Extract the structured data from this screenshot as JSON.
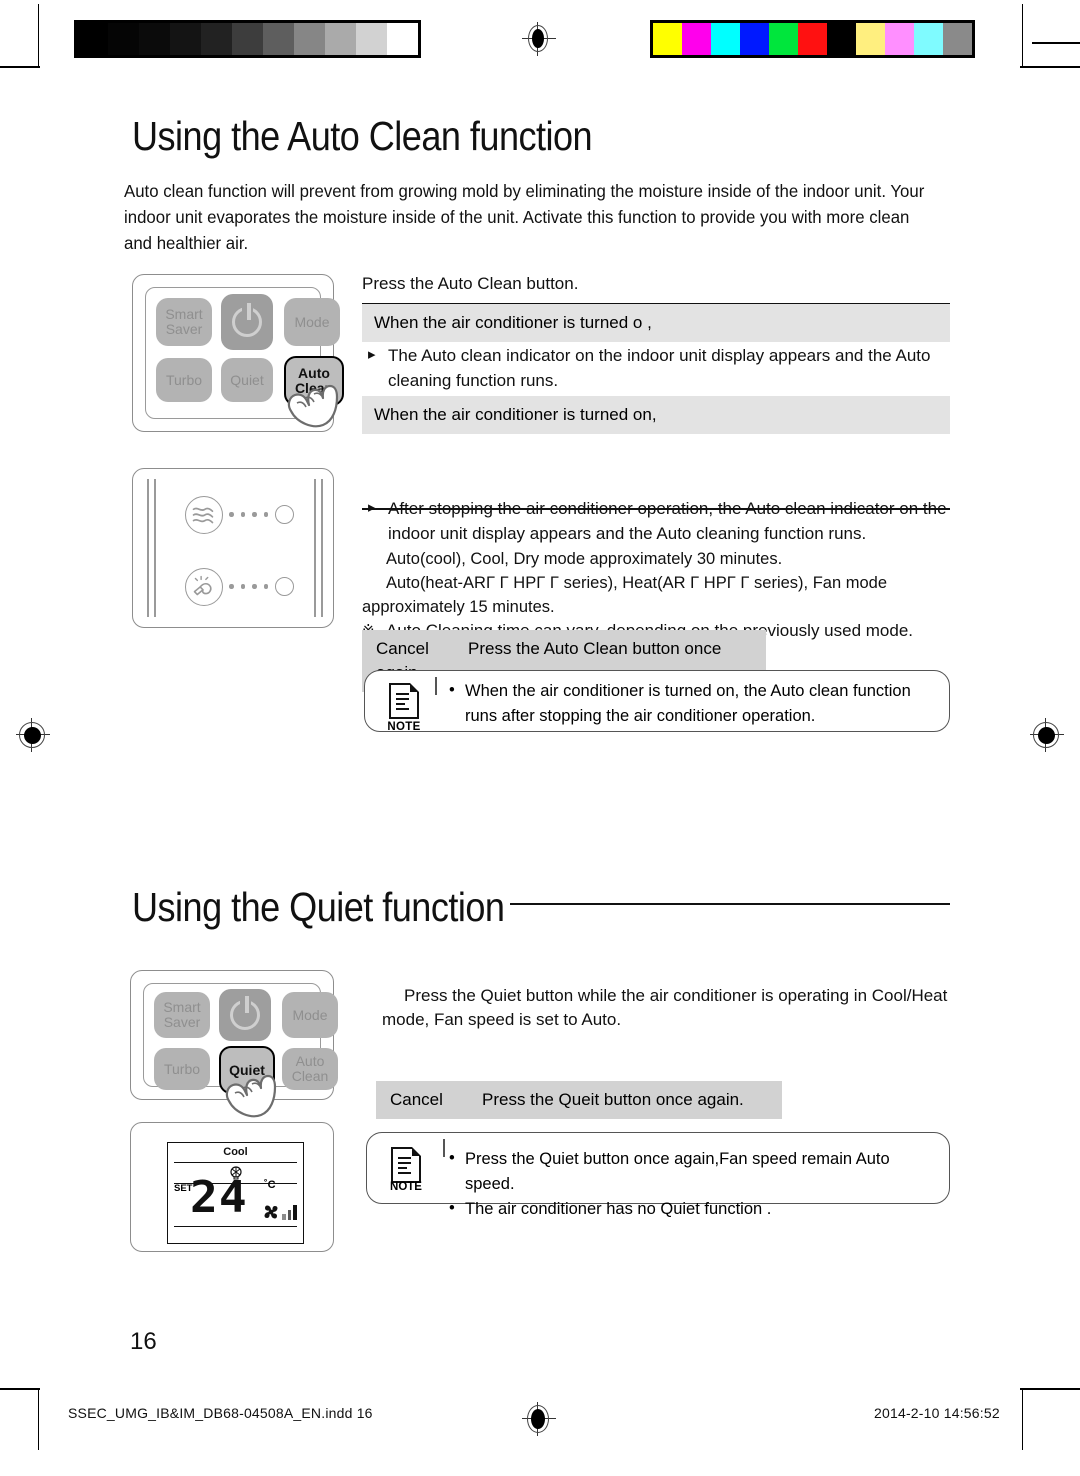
{
  "calibration": {
    "gray_steps": [
      "#000000",
      "#050505",
      "#0b0b0b",
      "#141414",
      "#222222",
      "#3d3d3d",
      "#5e5e5e",
      "#868686",
      "#aaaaaa",
      "#d2d2d2",
      "#ffffff"
    ],
    "color_swatches": [
      "#ffff00",
      "#ff00ec",
      "#00ffff",
      "#0019ff",
      "#00e63c",
      "#ff1111",
      "#000000",
      "#ffef7f",
      "#ff8fff",
      "#7ffbff",
      "#8a8a8a"
    ],
    "reg_mark": "registration-target"
  },
  "autoclean": {
    "title": "Using the Auto Clean function",
    "intro": "Auto clean function will prevent from growing mold by eliminating the moisture inside of the indoor unit. Your indoor unit evaporates the moisture inside of the unit. Activate this function to provide you with more clean and healthier air.",
    "remote": {
      "keys": [
        {
          "label_line1": "Smart",
          "label_line2": "Saver",
          "state": "normal"
        },
        {
          "label_line1": "",
          "label_line2": "",
          "state": "power"
        },
        {
          "label_line1": "Mode",
          "label_line2": "",
          "state": "normal"
        },
        {
          "label_line1": "Turbo",
          "label_line2": "",
          "state": "normal"
        },
        {
          "label_line1": "Quiet",
          "label_line2": "",
          "state": "normal"
        },
        {
          "label_line1": "Auto",
          "label_line2": "Clean",
          "state": "highlighted"
        }
      ]
    },
    "indoor_display": {
      "indicator_top": "airflow-icon",
      "indicator_bottom": "auto-clean-icon"
    },
    "lead": "Press the Auto Clean button.",
    "case_off_label": "When the air conditioner is turned o ,",
    "case_off_bullet": "The Auto clean indicator on the indoor unit display appears and the Auto cleaning function runs.",
    "case_on_label": "When the air conditioner is turned on,",
    "case_on_bullet": "After stopping the air conditioner operation, the Auto clean indicator on the indoor unit display appears and the Auto cleaning function runs.",
    "note_star": "Auto Cleaning time can vary, depending on the previously used mode.",
    "note_star_line1": "Auto(cool), Cool, Dry mode approximately 30 minutes.",
    "note_star_line2": "Auto(heat-ARΓ Γ HPΓ Γ  series), Heat(AR Γ HPΓ Γ  series), Fan mode",
    "note_star_line3": "approximately 15 minutes.",
    "cancel_label": "Cancel",
    "cancel_text": "Press the Auto Clean button once again.",
    "note_label": "NOTE",
    "note_lines": [
      "When the air conditioner is turned on, the Auto clean function runs after stopping the air conditioner operation."
    ]
  },
  "quiet": {
    "title": "Using the Quiet function",
    "remote": {
      "keys": [
        {
          "label_line1": "Smart",
          "label_line2": "Saver",
          "state": "normal"
        },
        {
          "label_line1": "",
          "label_line2": "",
          "state": "power"
        },
        {
          "label_line1": "Mode",
          "label_line2": "",
          "state": "normal"
        },
        {
          "label_line1": "Turbo",
          "label_line2": "",
          "state": "normal"
        },
        {
          "label_line1": "Quiet",
          "label_line2": "",
          "state": "highlighted"
        },
        {
          "label_line1": "Auto",
          "label_line2": "Clean",
          "state": "normal"
        }
      ]
    },
    "lcd": {
      "mode": "Cool",
      "set_label": "SET",
      "temperature": "24",
      "unit": "˚C",
      "fan_icon": "fan-icon",
      "signal_icon": "fan-speed-bars"
    },
    "lead": "Press the Quiet button while the air conditioner is operating in Cool/Heat mode, Fan speed is set to Auto.",
    "cancel_label": "Cancel",
    "cancel_text": "Press the Queit button once again.",
    "note_label": "NOTE",
    "note_lines": [
      "Press the Quiet button once again,Fan speed remain Auto speed.",
      "The air conditioner has no Quiet function ."
    ]
  },
  "footer": {
    "page_number": "16",
    "file_name": "SSEC_UMG_IB&IM_DB68-04508A_EN.indd   16",
    "timestamp": "2014-2-10   14:56:52"
  }
}
